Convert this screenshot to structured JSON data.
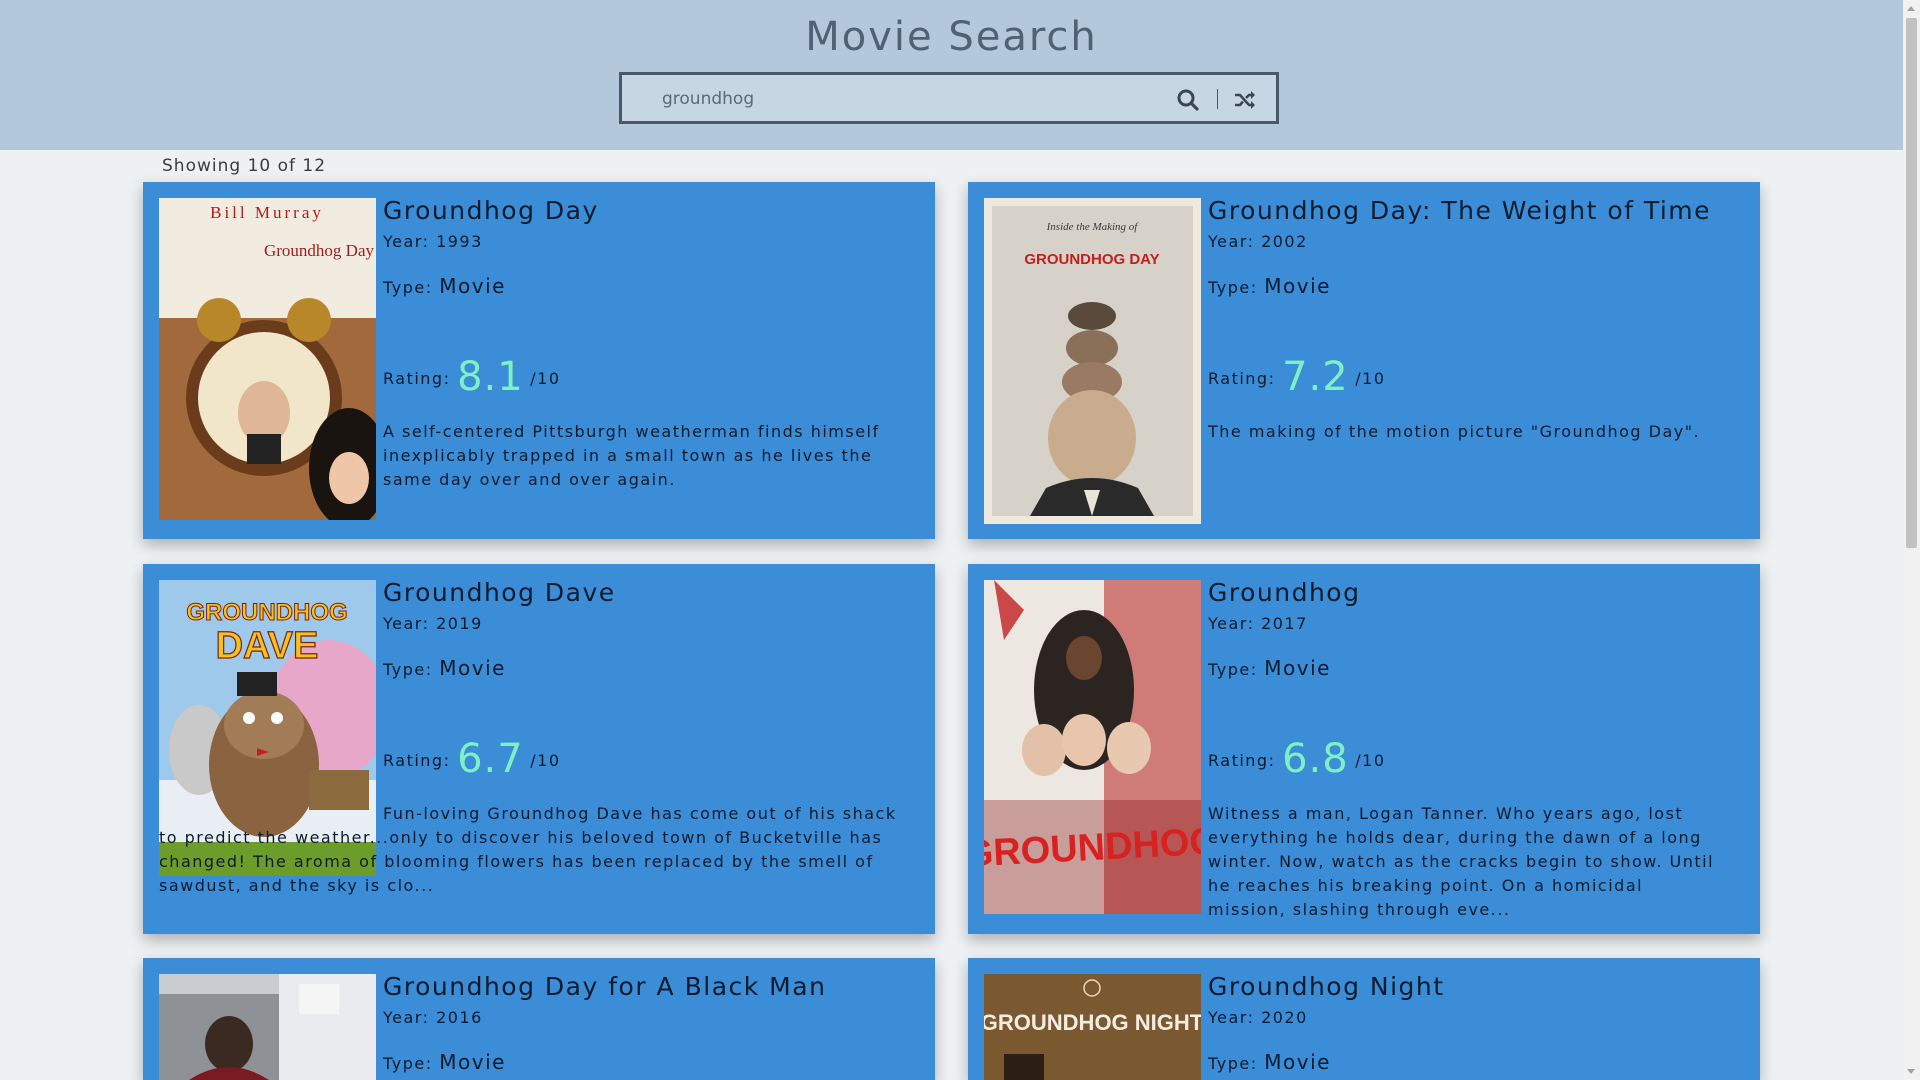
{
  "header": {
    "title": "Movie Search",
    "search_value": "groundhog"
  },
  "results": {
    "count_text": "Showing 10 of 12"
  },
  "cards": [
    {
      "title": "Groundhog Day",
      "year_label": "Year: 1993",
      "type_label": "Type: ",
      "type_value": "Movie",
      "rating_label": "Rating: ",
      "rating_value": "8.1",
      "rating_suffix": " /10",
      "description": "A self-centered Pittsburgh weatherman finds himself inexplicably trapped in a small town as he lives the same day over and over again.",
      "poster_icon": "alarm-clock-poster",
      "poster_text_top": "Bill Murray",
      "poster_text_main": "Groundhog Day"
    },
    {
      "title": "Groundhog Day: The Weight of Time",
      "year_label": "Year: 2002",
      "type_label": "Type: ",
      "type_value": "Movie",
      "rating_label": "Rating: ",
      "rating_value": "7.2",
      "rating_suffix": " /10",
      "description": "The making of the motion picture \"Groundhog Day\".",
      "poster_icon": "stacked-faces-poster",
      "poster_text_top": "Inside the Making of",
      "poster_text_main": "GROUNDHOG DAY"
    },
    {
      "title": "Groundhog Dave",
      "year_label": "Year: 2019",
      "type_label": "Type: ",
      "type_value": "Movie",
      "rating_label": "Rating: ",
      "rating_value": "6.7",
      "rating_suffix": " /10",
      "description": "Fun-loving Groundhog Dave has come out of his shack to predict the weather...only to discover his beloved town of Bucketville has changed! The aroma of blooming flowers has been replaced by the smell of sawdust, and the sky is clo...",
      "poster_icon": "cartoon-groundhog-poster",
      "poster_text_top": "GROUNDHOG",
      "poster_text_main": "DAVE"
    },
    {
      "title": "Groundhog",
      "year_label": "Year: 2017",
      "type_label": "Type: ",
      "type_value": "Movie",
      "rating_label": "Rating: ",
      "rating_value": "6.8",
      "rating_suffix": " /10",
      "description": "Witness a man, Logan Tanner. Who years ago, lost everything he holds dear, during the dawn of a long winter. Now, watch as the cracks begin to show. Until he reaches his breaking point. On a homicidal mission, slashing through eve...",
      "poster_icon": "horror-poster",
      "poster_text_top": "",
      "poster_text_main": "GROUNDHOG"
    },
    {
      "title": "Groundhog Day for A Black Man",
      "year_label": "Year: 2016",
      "type_label": "Type: ",
      "type_value": "Movie",
      "poster_icon": "car-window-poster"
    },
    {
      "title": "Groundhog Night",
      "year_label": "Year: 2020",
      "type_label": "Type: ",
      "type_value": "Movie",
      "poster_icon": "night-poster",
      "poster_text_main": "GROUNDHOG NIGHT"
    }
  ],
  "colors": {
    "header_bg": "#b3c8da",
    "card_bg": "#3b8dd8",
    "rating_accent": "#7ef1c2",
    "page_bg": "#eef1f4"
  },
  "icons": {
    "search": "search-icon",
    "shuffle": "shuffle-icon"
  }
}
